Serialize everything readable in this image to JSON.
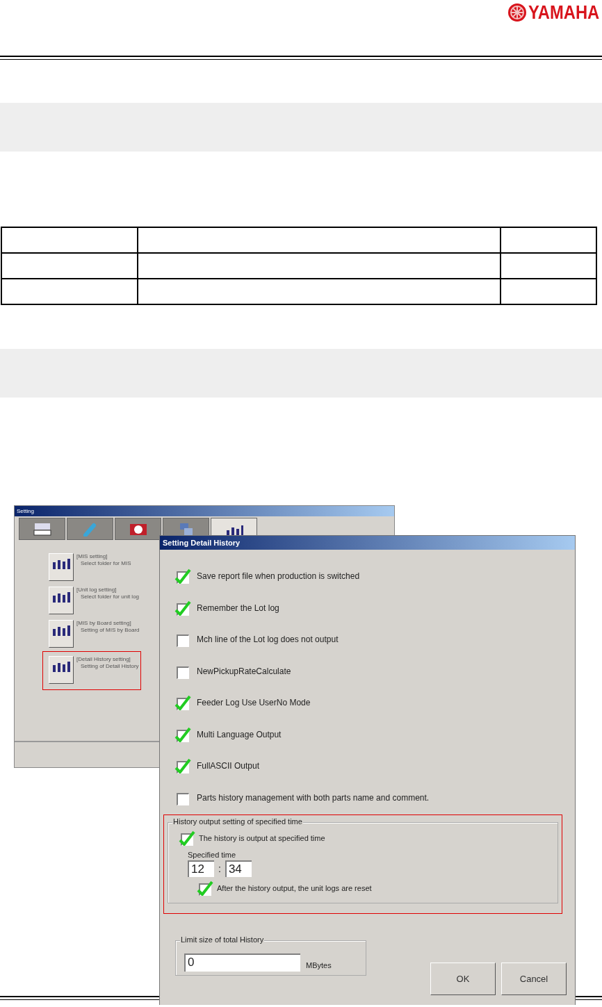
{
  "header": {
    "logo": "YAMAHA"
  },
  "settings_window": {
    "title": "Setting",
    "tabs": [
      {
        "selected": false
      },
      {
        "selected": false
      },
      {
        "selected": false
      },
      {
        "selected": false
      },
      {
        "selected": true
      }
    ],
    "items": [
      {
        "title": "[MIS setting]",
        "description": "Select folder for MIS",
        "highlighted": false
      },
      {
        "title": "[Unit log setting]",
        "description": "Select folder for unit log",
        "highlighted": false
      },
      {
        "title": "[MIS by Board setting]",
        "description": "Setting of MIS by Board",
        "highlighted": false
      },
      {
        "title": "[Detail History setting]",
        "description": "Setting of Detail History",
        "highlighted": true
      }
    ]
  },
  "dialog": {
    "title": "Setting Detail History",
    "options": [
      {
        "label": "Save report file when production is switched",
        "checked": true
      },
      {
        "label": "Remember the Lot log",
        "checked": true
      },
      {
        "label": "Mch line of the Lot log does not output",
        "checked": false
      },
      {
        "label": "NewPickupRateCalculate",
        "checked": false
      },
      {
        "label": "Feeder Log Use UserNo Mode",
        "checked": true
      },
      {
        "label": "Multi Language Output",
        "checked": true
      },
      {
        "label": "FullASCII Output",
        "checked": true
      },
      {
        "label": "Parts history management with both parts name and comment.",
        "checked": false
      }
    ],
    "time_group": {
      "title": "History output setting of specified time",
      "highlighted": true,
      "option": {
        "label": "The history is output at specified time",
        "checked": true
      },
      "time_label": "Specified time",
      "hour": "12",
      "separator": ":",
      "minute": "34",
      "reset_option": {
        "label": "After the history output, the unit logs are reset",
        "checked": true
      }
    },
    "limit_group": {
      "title": "Limit size of total History",
      "value": "0",
      "unit": "MBytes"
    },
    "buttons": [
      "OK",
      "Cancel"
    ]
  }
}
